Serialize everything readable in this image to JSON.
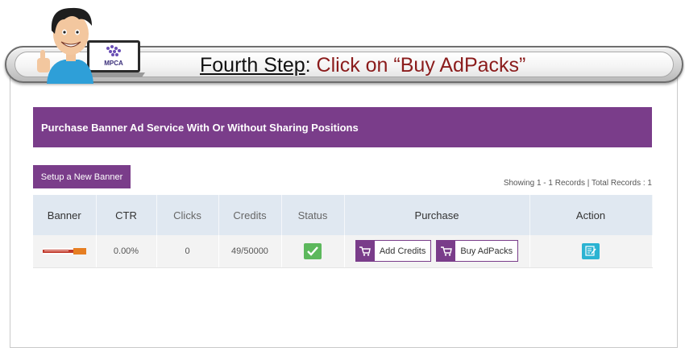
{
  "step": {
    "lead": "Fourth Step",
    "colon": ": ",
    "action": "Click on “Buy AdPacks”"
  },
  "mascot": {
    "laptop_label": "MPCA"
  },
  "panel": {
    "title": "Purchase Banner Ad Service With Or Without Sharing Positions"
  },
  "toolbar": {
    "new_banner_label": "Setup a New Banner",
    "records_info": "Showing 1 - 1 Records | Total Records : 1"
  },
  "table": {
    "headers": [
      "Banner",
      "CTR",
      "Clicks",
      "Credits",
      "Status",
      "Purchase",
      "Action"
    ],
    "rows": [
      {
        "banner_icon": "banner-thumbnail",
        "ctr": "0.00%",
        "clicks": "0",
        "credits": "49/50000",
        "status_icon": "check-icon",
        "add_credits_label": "Add Credits",
        "buy_adpacks_label": "Buy AdPacks",
        "action_icon": "edit-icon"
      }
    ]
  },
  "colors": {
    "accent_purple": "#7a3d8a",
    "header_row": "#e0e8f1",
    "status_green": "#5cb85c",
    "edit_cyan": "#2bb3d2",
    "step_action_red": "#8b1c1c"
  }
}
